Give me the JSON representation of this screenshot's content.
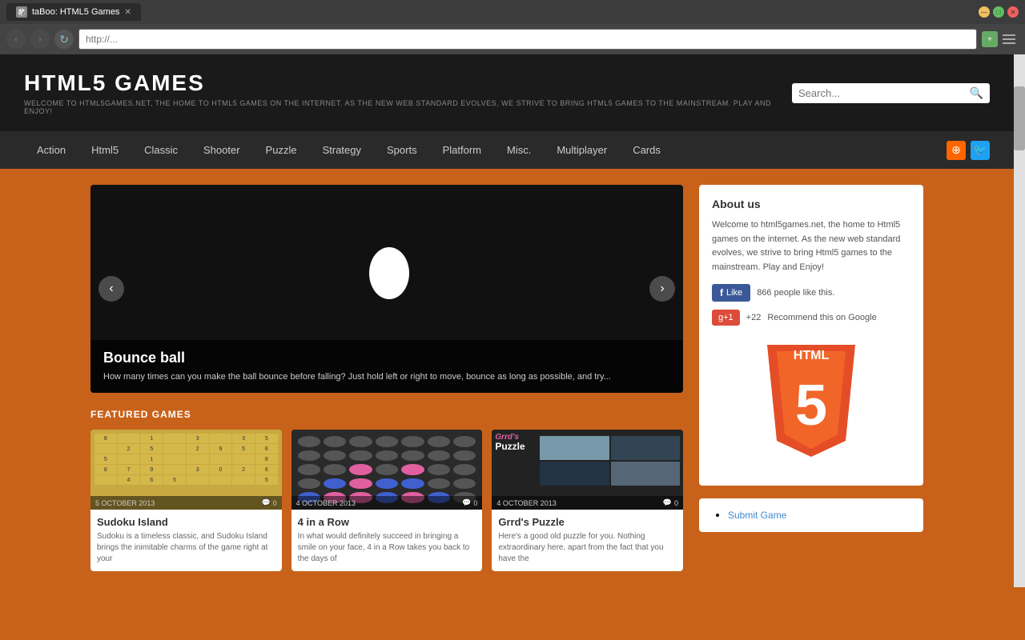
{
  "browser": {
    "tab_title": "taBoo: HTML5 Games",
    "tab_icon": "🎲",
    "address_value": "",
    "window_controls": {
      "minimize": "—",
      "restore": "□",
      "close": "✕"
    }
  },
  "header": {
    "site_title": "HTML5 GAMES",
    "tagline": "WELCOME TO HTML5GAMES.NET, THE HOME TO HTML5 GAMES ON THE INTERNET. AS THE NEW WEB STANDARD EVOLVES, WE STRIVE TO BRING HTML5 GAMES TO THE MAINSTREAM. PLAY AND ENJOY!",
    "search_placeholder": "Search..."
  },
  "nav": {
    "items": [
      {
        "label": "Action",
        "href": "#"
      },
      {
        "label": "Html5",
        "href": "#"
      },
      {
        "label": "Classic",
        "href": "#"
      },
      {
        "label": "Shooter",
        "href": "#"
      },
      {
        "label": "Puzzle",
        "href": "#"
      },
      {
        "label": "Strategy",
        "href": "#"
      },
      {
        "label": "Sports",
        "href": "#"
      },
      {
        "label": "Platform",
        "href": "#"
      },
      {
        "label": "Misc.",
        "href": "#"
      },
      {
        "label": "Multiplayer",
        "href": "#"
      },
      {
        "label": "Cards",
        "href": "#"
      }
    ]
  },
  "slider": {
    "title": "Bounce ball",
    "description": "How many times can you make the ball bounce before falling? Just hold left or right to move, bounce as long as possible, and try...",
    "prev_label": "‹",
    "next_label": "›"
  },
  "featured": {
    "section_title": "FEATURED GAMES",
    "games": [
      {
        "name": "Sudoku Island",
        "date": "5 OCTOBER 2013",
        "comments": "0",
        "description": "Sudoku is a timeless classic, and Sudoku Island brings the inimitable charms of the game right at your"
      },
      {
        "name": "4 in a Row",
        "date": "4 OCTOBER 2013",
        "comments": "0",
        "description": "In what would definitely succeed in bringing a smile on your face, 4 in a Row takes you back to the days of"
      },
      {
        "name": "Grrd's Puzzle",
        "date": "4 OCTOBER 2013",
        "comments": "0",
        "description": "Here's a good old puzzle for you. Nothing extraordinary here, apart from the fact that you have the"
      }
    ]
  },
  "sidebar": {
    "about": {
      "title": "About us",
      "text": "Welcome to html5games.net, the home to Html5 games on the internet. As the new web standard evolves, we strive to bring Html5 games to the mainstream. Play and Enjoy!",
      "fb_count": "866 people like this.",
      "gplus_count": "+22",
      "gplus_text": "Recommend this on Google"
    },
    "html5_logo": {
      "text": "HTML",
      "number": "5"
    },
    "submit": {
      "link_text": "Submit Game"
    }
  }
}
